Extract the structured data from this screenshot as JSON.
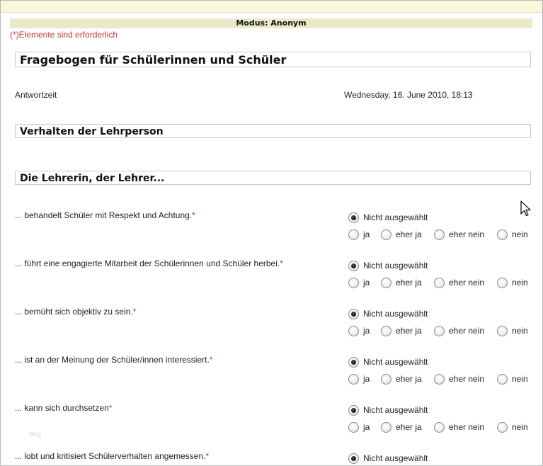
{
  "mode_label": "Modus: Anonym",
  "required_note": "(*)Elemente sind erforderlich",
  "form_title": "Fragebogen für Schülerinnen und Schüler",
  "answer_time": {
    "label": "Antwortzeit",
    "value": "Wednesday, 16. June 2010, 18:13"
  },
  "section_heading": "Verhalten der Lehrperson",
  "subsection_heading": "Die Lehrerin, der Lehrer...",
  "options": {
    "none": "Nicht ausgewählt",
    "ja": "ja",
    "eher_ja": "eher ja",
    "eher_nein": "eher nein",
    "nein": "nein"
  },
  "required_marker": "*",
  "questions": [
    {
      "text": "... behandelt Schüler mit Respekt und Achtung.",
      "selected": "Nicht ausgewählt"
    },
    {
      "text": "... führt eine engagierte Mitarbeit der Schülerinnen und Schüler herbei.",
      "selected": "Nicht ausgewählt"
    },
    {
      "text": "... bemüht sich objektiv zu sein.",
      "selected": "Nicht ausgewählt"
    },
    {
      "text": "... ist an der Meinung der Schüler/innen interessiert.",
      "selected": "Nicht ausgewählt"
    },
    {
      "text": "... kann sich durchsetzen",
      "selected": "Nicht ausgewählt"
    },
    {
      "text": "... lobt und kritisiert Schülerverhalten angemessen.",
      "selected": "Nicht ausgewählt"
    }
  ],
  "watermark": "blog",
  "icons": {
    "cursor": "mouse-pointer-icon"
  }
}
